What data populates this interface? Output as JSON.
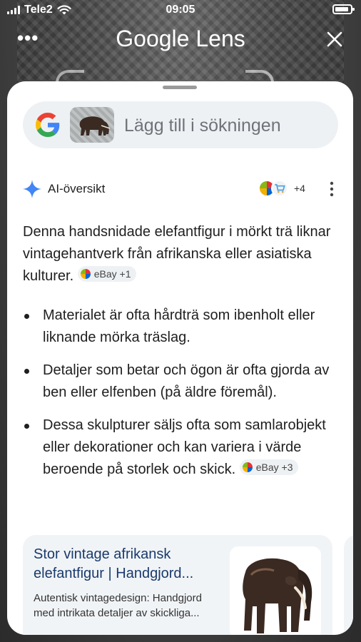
{
  "status_bar": {
    "carrier": "Tele2",
    "time": "09:05"
  },
  "header": {
    "title": "Google Lens",
    "more_icon": "more-dots-icon",
    "close_icon": "close-icon"
  },
  "search": {
    "placeholder": "Lägg till i sökningen",
    "logo_icon": "google-g-icon"
  },
  "ai_overview": {
    "label": "AI-översikt",
    "sources_more": "+4",
    "summary": "Denna handsnidade elefantfigur i mörkt trä liknar vintagehantverk från afrikanska eller asiatiska kulturer.",
    "summary_chip": "eBay +1",
    "bullets": [
      {
        "text": "Materialet är ofta hårdträ som ibenholt eller liknande mörka träslag."
      },
      {
        "text": "Detaljer som betar och ögon är ofta gjorda av ben eller elfenben (på äldre föremål)."
      },
      {
        "text": "Dessa skulpturer säljs ofta som samlarobjekt eller dekorationer och kan variera i värde beroende på storlek och skick.",
        "chip": "eBay +3"
      }
    ]
  },
  "result_card": {
    "title": "Stor vintage afrikansk elefantfigur | Handgjord...",
    "description": "Autentisk vintagedesign: Handgjord med intrikata detaljer av skickliga..."
  },
  "colors": {
    "accent_blue": "#4285F4",
    "result_title": "#1a3a6b",
    "pill_bg": "#eef1f4"
  }
}
